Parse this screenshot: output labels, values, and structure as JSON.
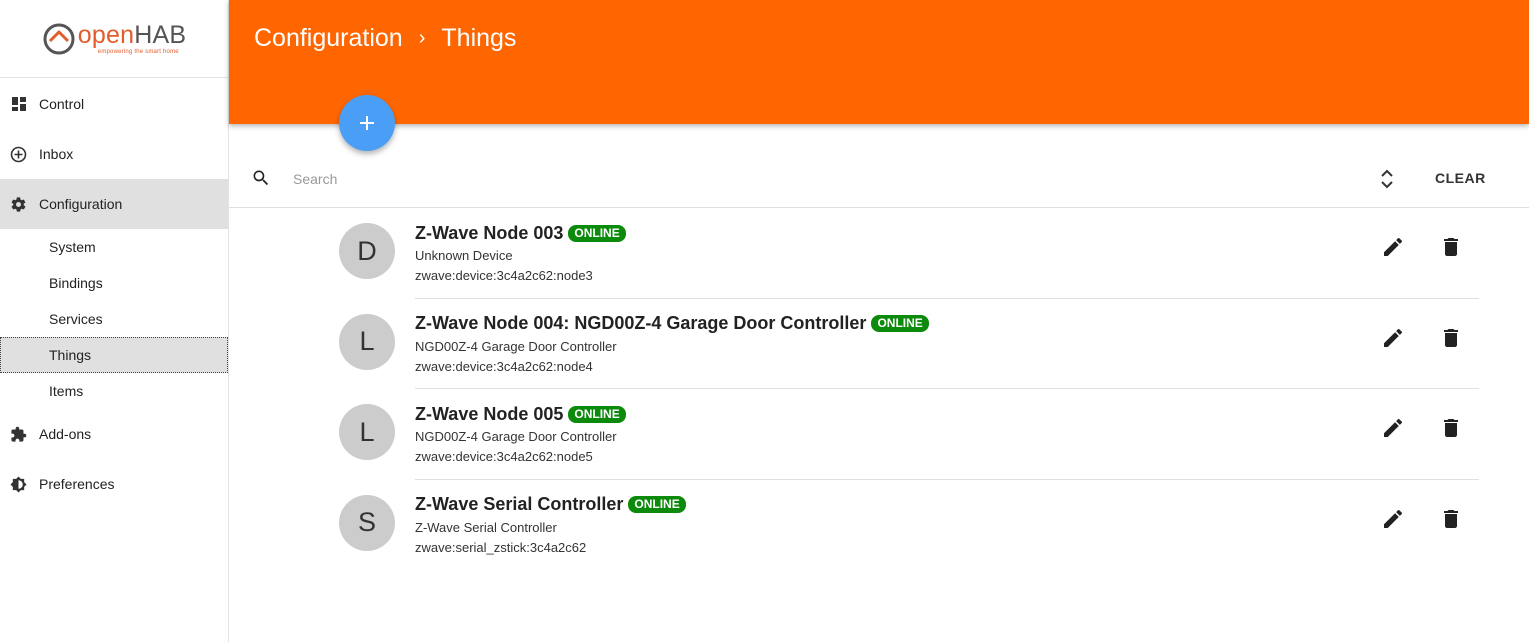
{
  "app": {
    "logo_prefix": "open",
    "logo_suffix": "HAB",
    "logo_tagline": "empowering the smart home"
  },
  "sidebar": {
    "items": [
      {
        "label": "Control",
        "icon": "dashboard-icon"
      },
      {
        "label": "Inbox",
        "icon": "add-circle-icon"
      },
      {
        "label": "Configuration",
        "icon": "gear-icon"
      },
      {
        "label": "Add-ons",
        "icon": "puzzle-icon"
      },
      {
        "label": "Preferences",
        "icon": "brightness-icon"
      }
    ],
    "sub_items": [
      {
        "label": "System"
      },
      {
        "label": "Bindings"
      },
      {
        "label": "Services"
      },
      {
        "label": "Things"
      },
      {
        "label": "Items"
      }
    ],
    "active_item": "Configuration",
    "active_sub_item": "Things"
  },
  "header": {
    "breadcrumb": [
      "Configuration",
      "Things"
    ],
    "separator": "›",
    "background_color": "#ff6600"
  },
  "fab": {
    "label": "+",
    "color": "#4a9ef5"
  },
  "search": {
    "placeholder": "Search",
    "value": "",
    "clear_label": "CLEAR"
  },
  "things": [
    {
      "avatar": "D",
      "title": "Z-Wave Node 003",
      "status": "ONLINE",
      "subtitle": "Unknown Device",
      "uid": "zwave:device:3c4a2c62:node3"
    },
    {
      "avatar": "L",
      "title": "Z-Wave Node 004: NGD00Z-4 Garage Door Controller",
      "status": "ONLINE",
      "subtitle": "NGD00Z-4 Garage Door Controller",
      "uid": "zwave:device:3c4a2c62:node4"
    },
    {
      "avatar": "L",
      "title": "Z-Wave Node 005",
      "status": "ONLINE",
      "subtitle": "NGD00Z-4 Garage Door Controller",
      "uid": "zwave:device:3c4a2c62:node5"
    },
    {
      "avatar": "S",
      "title": "Z-Wave Serial Controller",
      "status": "ONLINE",
      "subtitle": "Z-Wave Serial Controller",
      "uid": "zwave:serial_zstick:3c4a2c62"
    }
  ],
  "colors": {
    "accent": "#ff6600",
    "online": "#0b8a0b",
    "avatar_bg": "#cccccc"
  }
}
